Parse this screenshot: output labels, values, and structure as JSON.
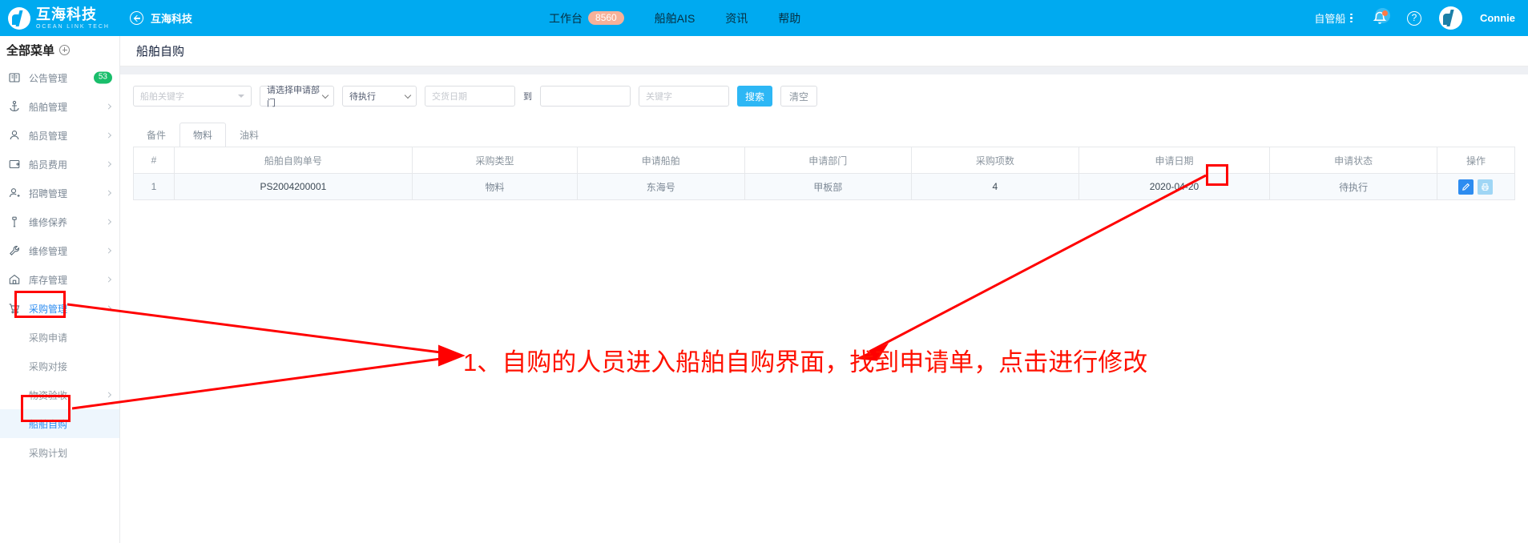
{
  "header": {
    "brand_cn": "互海科技",
    "brand_en": "OCEAN LINK TECH",
    "sub_brand": "互海科技",
    "nav": [
      {
        "label": "工作台",
        "badge": "8560"
      },
      {
        "label": "船舶AIS",
        "badge": ""
      },
      {
        "label": "资讯",
        "badge": ""
      },
      {
        "label": "帮助",
        "badge": ""
      }
    ],
    "vessel_selector": "自管船",
    "user_name": "Connie",
    "icons": {
      "back": "back-arrow-circle-icon",
      "bell": "bell-icon",
      "help": "question-circle-icon",
      "avatar": "avatar-icon"
    }
  },
  "sidebar": {
    "title": "全部菜单",
    "add_icon": "plus-circle-icon",
    "items": [
      {
        "label": "公告管理",
        "icon": "announcement-icon",
        "badge": "53",
        "chevron": false,
        "active": false
      },
      {
        "label": "船舶管理",
        "icon": "anchor-icon",
        "badge": "",
        "chevron": true,
        "active": false
      },
      {
        "label": "船员管理",
        "icon": "crew-icon",
        "badge": "",
        "chevron": true,
        "active": false
      },
      {
        "label": "船员费用",
        "icon": "expense-card-icon",
        "badge": "",
        "chevron": true,
        "active": false
      },
      {
        "label": "招聘管理",
        "icon": "recruit-icon",
        "badge": "",
        "chevron": true,
        "active": false
      },
      {
        "label": "维修保养",
        "icon": "maintenance-icon",
        "badge": "",
        "chevron": true,
        "active": false
      },
      {
        "label": "维修管理",
        "icon": "wrench-icon",
        "badge": "",
        "chevron": true,
        "active": false
      },
      {
        "label": "库存管理",
        "icon": "warehouse-icon",
        "badge": "",
        "chevron": true,
        "active": false
      },
      {
        "label": "采购管理",
        "icon": "cart-icon",
        "badge": "",
        "chevron": true,
        "active": true
      }
    ],
    "sub_items": [
      {
        "label": "采购申请",
        "chevron": false,
        "selected": false
      },
      {
        "label": "采购对接",
        "chevron": false,
        "selected": false
      },
      {
        "label": "物资验收",
        "chevron": true,
        "selected": false
      },
      {
        "label": "船舶自购",
        "chevron": false,
        "selected": true
      },
      {
        "label": "采购计划",
        "chevron": false,
        "selected": false
      }
    ]
  },
  "page": {
    "title": "船舶自购"
  },
  "filters": {
    "vessel_keyword_placeholder": "船舶关键字",
    "department_value": "请选择申请部门",
    "status_value": "待执行",
    "date_from_placeholder": "交货日期",
    "date_to_placeholder": "",
    "range_separator": "到",
    "keyword_placeholder": "关键字",
    "search_label": "搜索",
    "clear_label": "清空"
  },
  "tabs": [
    {
      "label": "备件",
      "active": false
    },
    {
      "label": "物料",
      "active": true
    },
    {
      "label": "油料",
      "active": false
    }
  ],
  "table": {
    "columns": [
      "#",
      "船舶自购单号",
      "采购类型",
      "申请船舶",
      "申请部门",
      "采购项数",
      "申请日期",
      "申请状态",
      "操作"
    ],
    "rows": [
      {
        "index": "1",
        "order_no": "PS2004200001",
        "purchase_type": "物料",
        "vessel": "东海号",
        "department": "甲板部",
        "item_count": "4",
        "apply_date": "2020-04-20",
        "status": "待执行",
        "actions": [
          "edit-icon",
          "print-icon"
        ]
      }
    ]
  },
  "annotation": {
    "text": "1、自购的人员进入船舶自购界面，找到申请单，点击进行修改",
    "color": "#ff1100",
    "highlight_boxes": [
      "采购管理",
      "船舶自购",
      "操作-编辑按钮"
    ]
  },
  "colors": {
    "brand_blue": "#00aaf0",
    "accent_blue": "#2d8cf0",
    "button_blue": "#2db7f5",
    "badge_green": "#19be6b",
    "badge_orange": "#f7b199",
    "annotation_red": "#ff0000"
  }
}
